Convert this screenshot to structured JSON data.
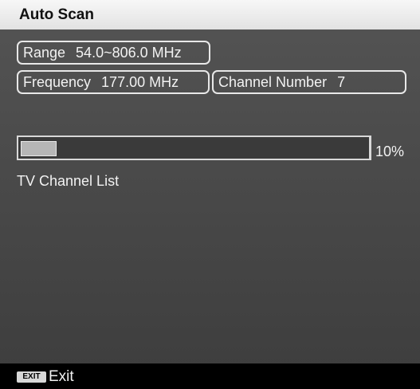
{
  "title": "Auto Scan",
  "range": {
    "label": "Range",
    "value": "54.0~806.0 MHz"
  },
  "frequency": {
    "label": "Frequency",
    "value": "177.00 MHz"
  },
  "channel": {
    "label": "Channel Number",
    "value": "7"
  },
  "progress": {
    "fraction": 0.1,
    "text": "10%"
  },
  "channel_list": {
    "label": "TV Channel List",
    "items": []
  },
  "footer": {
    "key_label": "EXIT",
    "action_label": "Exit"
  }
}
